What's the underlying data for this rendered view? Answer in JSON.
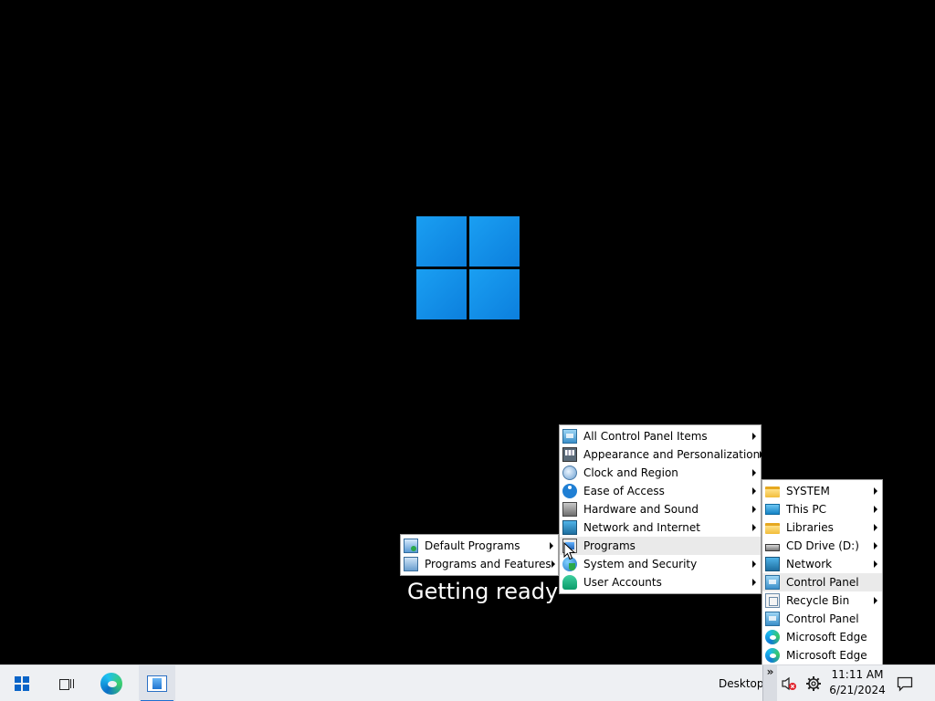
{
  "boot_screen": {
    "status_text": "Getting ready"
  },
  "programs_submenu": {
    "items": [
      {
        "label": "Default Programs",
        "icon": "default-programs-icon",
        "has_submenu": true
      },
      {
        "label": "Programs and Features",
        "icon": "programs-features-icon",
        "has_submenu": true
      }
    ]
  },
  "control_panel_menu": {
    "items": [
      {
        "label": "All Control Panel Items",
        "icon": "control-panel-icon",
        "has_submenu": true
      },
      {
        "label": "Appearance and Personalization",
        "icon": "appearance-icon",
        "has_submenu": true
      },
      {
        "label": "Clock and Region",
        "icon": "clock-icon",
        "has_submenu": true
      },
      {
        "label": "Ease of Access",
        "icon": "ease-of-access-icon",
        "has_submenu": true
      },
      {
        "label": "Hardware and Sound",
        "icon": "hardware-icon",
        "has_submenu": true
      },
      {
        "label": "Network and Internet",
        "icon": "network-icon",
        "has_submenu": true
      },
      {
        "label": "Programs",
        "icon": "programs-icon",
        "has_submenu": false,
        "hovered": true
      },
      {
        "label": "System and Security",
        "icon": "security-icon",
        "has_submenu": true
      },
      {
        "label": "User Accounts",
        "icon": "user-icon",
        "has_submenu": true
      }
    ]
  },
  "desktop_menu": {
    "items": [
      {
        "label": "SYSTEM",
        "icon": "folder-icon",
        "has_submenu": true
      },
      {
        "label": "This PC",
        "icon": "computer-icon",
        "has_submenu": true
      },
      {
        "label": "Libraries",
        "icon": "folder-icon",
        "has_submenu": true
      },
      {
        "label": "CD Drive (D:)",
        "icon": "cd-drive-icon",
        "has_submenu": true
      },
      {
        "label": "Network",
        "icon": "network-icon",
        "has_submenu": true
      },
      {
        "label": "Control Panel",
        "icon": "control-panel-icon",
        "has_submenu": false,
        "hovered": true
      },
      {
        "label": "Recycle Bin",
        "icon": "recycle-bin-icon",
        "has_submenu": true
      },
      {
        "label": "Control Panel",
        "icon": "control-panel-icon",
        "has_submenu": false
      },
      {
        "label": "Microsoft Edge",
        "icon": "edge-icon",
        "has_submenu": false
      },
      {
        "label": "Microsoft Edge",
        "icon": "edge-icon",
        "has_submenu": false
      }
    ]
  },
  "taskbar": {
    "toolbar_label": "Desktop",
    "chevron": "»",
    "time": "11:11 AM",
    "date": "6/21/2024"
  },
  "colors": {
    "desktop_bg": "#000000",
    "logo_blue": "#0c7fdd",
    "taskbar_bg": "#eef0f3",
    "active_indicator": "#1f6fd0"
  }
}
